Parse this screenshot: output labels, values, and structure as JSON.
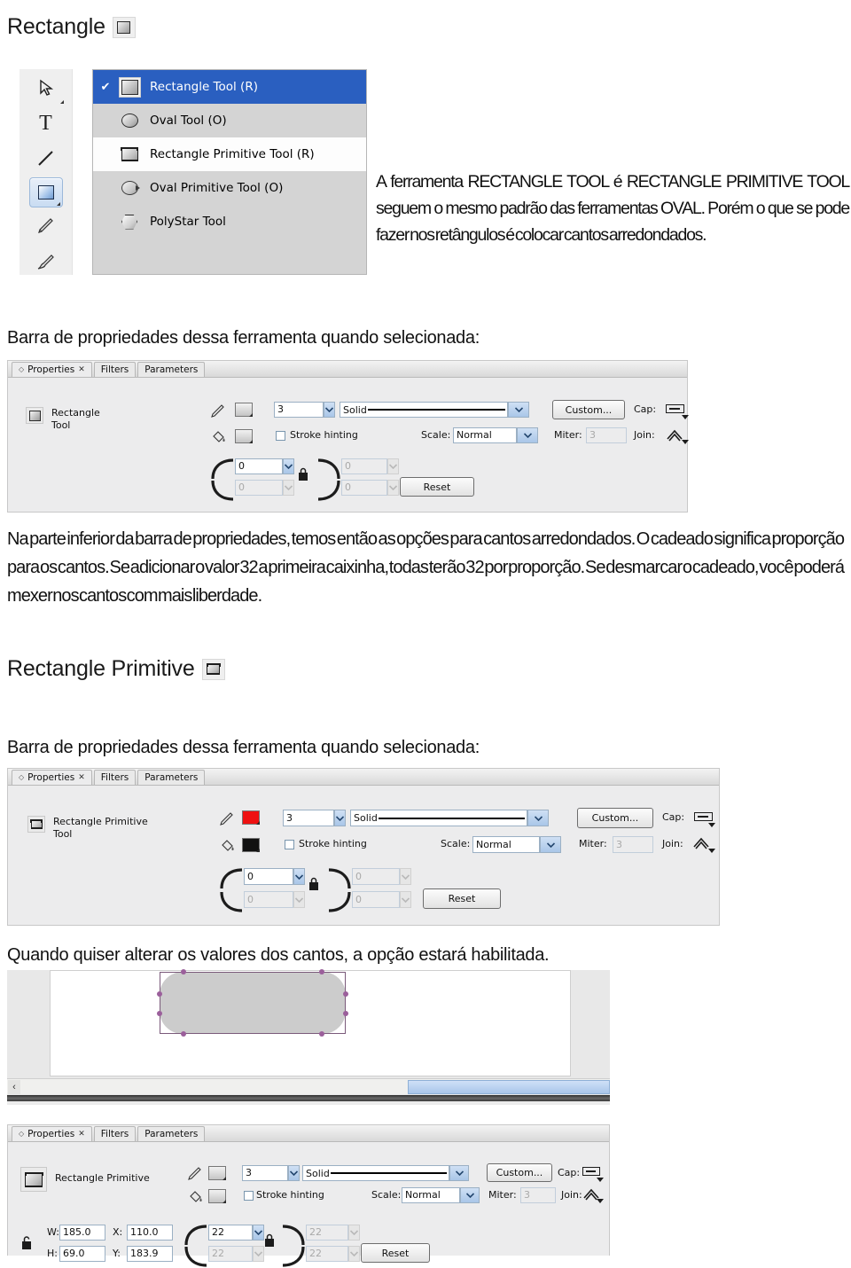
{
  "document": {
    "heading1": "Rectangle",
    "heading1_icon": "rectangle-tool-icon",
    "paragraph_intro": "A ferramenta RECTANGLE TOOL é RECTANGLE PRIMITIVE TOOL seguem o mesmo padrão das ferramentas OVAL. Porém o que se pode fazer nos retângulos é colocar cantos arredondados.",
    "caption1": "Barra de propriedades dessa ferramenta quando selecionada:",
    "paragraph_body": "Na parte inferior da barra de propriedades, temos então as opções para cantos arredondados. O cadeado significa proporção para os cantos. Se adicionar o valor 32 a primeira caixinha, todas terão 32 por proporção. Se desmarcar o cadeado, você poderá mexer nos cantos com mais liberdade.",
    "heading2": "Rectangle Primitive",
    "heading2_icon": "rectangle-primitive-tool-icon",
    "caption2": "Barra de propriedades dessa ferramenta quando selecionada:",
    "caption3": "Quando quiser alterar os valores dos cantos, a opção estará habilitada."
  },
  "toolbar": {
    "items": [
      {
        "name": "subselection-tool",
        "icon": "arrow-subselect-icon",
        "selected": false
      },
      {
        "name": "text-tool",
        "icon": "text-T-icon",
        "selected": false
      },
      {
        "name": "line-tool",
        "icon": "line-icon",
        "selected": false
      },
      {
        "name": "rectangle-tool",
        "icon": "rectangle-icon",
        "selected": true
      },
      {
        "name": "pencil-tool",
        "icon": "pencil-icon",
        "selected": false
      },
      {
        "name": "brush-tool",
        "icon": "brush-icon",
        "selected": false
      }
    ]
  },
  "tool_menu": {
    "items": [
      {
        "label": "Rectangle Tool (R)",
        "icon": "rectangle-icon",
        "checked": true,
        "highlight": true,
        "bg": "highlight"
      },
      {
        "label": "Oval Tool (O)",
        "icon": "oval-icon",
        "checked": false,
        "highlight": false,
        "bg": "grey"
      },
      {
        "label": "Rectangle Primitive Tool (R)",
        "icon": "rectangle-primitive-icon",
        "checked": false,
        "highlight": false,
        "bg": "white"
      },
      {
        "label": "Oval Primitive Tool (O)",
        "icon": "oval-primitive-icon",
        "checked": false,
        "highlight": false,
        "bg": "grey"
      },
      {
        "label": "PolyStar Tool",
        "icon": "polystar-icon",
        "checked": false,
        "highlight": false,
        "bg": "grey"
      }
    ],
    "check_glyph": "✔",
    "highlight_color": "#2a5fc0"
  },
  "panel1": {
    "tabs": [
      {
        "label": "Properties",
        "active": true,
        "closable": true
      },
      {
        "label": "Filters",
        "active": false,
        "closable": false
      },
      {
        "label": "Parameters",
        "active": false,
        "closable": false
      }
    ],
    "tool_label_line1": "Rectangle",
    "tool_label_line2": "Tool",
    "stroke_width": "3",
    "stroke_style": "Solid",
    "stroke_hinting_label": "Stroke hinting",
    "stroke_hinting_checked": false,
    "custom_button": "Custom...",
    "cap_label": "Cap:",
    "scale_label": "Scale:",
    "scale_value": "Normal",
    "miter_label": "Miter:",
    "miter_value": "3",
    "join_label": "Join:",
    "corner_tl": "0",
    "corner_tr": "0",
    "corner_bl": "0",
    "corner_br": "0",
    "reset_button": "Reset",
    "lock_state": "locked",
    "stroke_color": "#cfcfcf",
    "fill_color": "#cfcfcf"
  },
  "panel2": {
    "tabs": [
      {
        "label": "Properties",
        "active": true,
        "closable": true
      },
      {
        "label": "Filters",
        "active": false,
        "closable": false
      },
      {
        "label": "Parameters",
        "active": false,
        "closable": false
      }
    ],
    "tool_label_line1": "Rectangle Primitive",
    "tool_label_line2": "Tool",
    "stroke_width": "3",
    "stroke_style": "Solid",
    "stroke_hinting_label": "Stroke hinting",
    "stroke_hinting_checked": false,
    "custom_button": "Custom...",
    "cap_label": "Cap:",
    "scale_label": "Scale:",
    "scale_value": "Normal",
    "miter_label": "Miter:",
    "miter_value": "3",
    "join_label": "Join:",
    "corner_tl": "0",
    "corner_tr": "0",
    "corner_bl": "0",
    "corner_br": "0",
    "reset_button": "Reset",
    "lock_state": "locked",
    "stroke_color": "#ee1111",
    "fill_color": "#111111"
  },
  "panel3": {
    "tabs": [
      {
        "label": "Properties",
        "active": true,
        "closable": true
      },
      {
        "label": "Filters",
        "active": false,
        "closable": false
      },
      {
        "label": "Parameters",
        "active": false,
        "closable": false
      }
    ],
    "tool_label_line1": "Rectangle Primitive",
    "tool_label_line2": "",
    "stroke_width": "3",
    "stroke_style": "Solid",
    "stroke_hinting_label": "Stroke hinting",
    "stroke_hinting_checked": false,
    "custom_button": "Custom...",
    "cap_label": "Cap:",
    "scale_label": "Scale:",
    "scale_value": "Normal",
    "miter_label": "Miter:",
    "miter_value": "3",
    "join_label": "Join:",
    "w_label": "W:",
    "w_value": "185.0",
    "h_label": "H:",
    "h_value": "69.0",
    "x_label": "X:",
    "x_value": "110.0",
    "y_label": "Y:",
    "y_value": "183.9",
    "corner_tl": "22",
    "corner_tr": "22",
    "corner_bl": "22",
    "corner_br": "22",
    "reset_button": "Reset",
    "lock_state": "unlocked",
    "corner_lock_state": "locked",
    "stroke_color": "#cfcfcf",
    "fill_color": "#cfcfcf"
  },
  "stage": {
    "shape": "rounded-rectangle",
    "shape_fill": "#cccccc",
    "shape_stroke": "#7a5a7a",
    "handle_color": "#9b5f9b",
    "scroll_left_arrow": "‹"
  }
}
